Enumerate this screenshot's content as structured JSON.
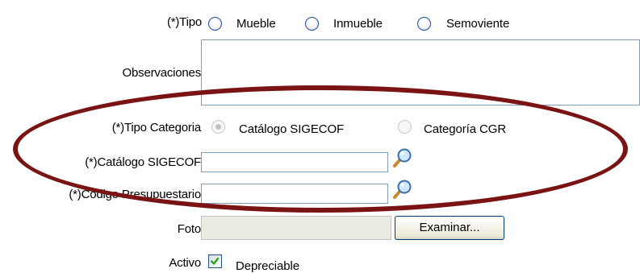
{
  "form": {
    "tipo": {
      "label": "(*)Tipo",
      "options": [
        "Mueble",
        "Inmueble",
        "Semoviente"
      ]
    },
    "observaciones": {
      "label": "Observaciones",
      "value": ""
    },
    "tipo_categoria": {
      "label": "(*)Tipo Categoria",
      "options": [
        "Catálogo SIGECOF",
        "Categoría CGR"
      ],
      "selected": "Catálogo SIGECOF"
    },
    "catalogo_sigecof": {
      "label": "(*)Catálogo SIGECOF",
      "value": ""
    },
    "codigo_presupuestario": {
      "label": "(*)Código Presupuestario",
      "value": ""
    },
    "foto": {
      "label": "Foto",
      "value": "",
      "browse_label": "Examinar..."
    },
    "activo": {
      "label": "Activo",
      "checked": true,
      "checkbox_label": "Depreciable"
    }
  },
  "icons": {
    "search": "magnifier-icon",
    "checkbox_check": "checkmark-icon"
  },
  "colors": {
    "annotation_ellipse": "#7a1414",
    "field_border": "#7f9db9",
    "radio_border": "#1f4aa3",
    "check_mark": "#21a121"
  }
}
